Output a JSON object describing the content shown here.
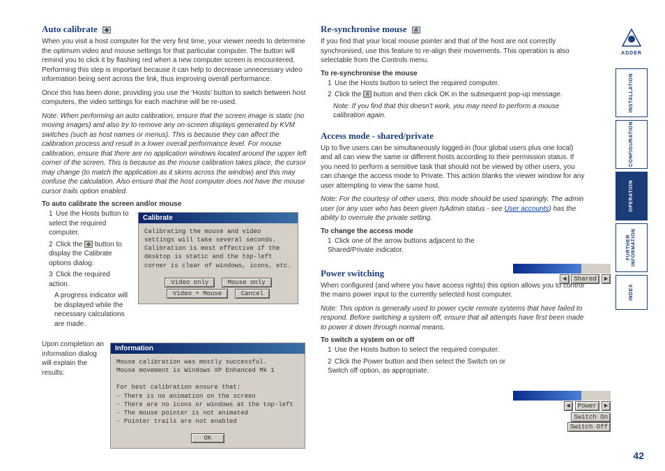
{
  "left": {
    "h1": "Auto calibrate",
    "p1": "When you visit a host computer for the very first time, your viewer needs to determine the optimum video and mouse settings for that particular computer. The button will remind you to click it by flashing red when a new computer screen is encountered. Performing this step is important because it can help to decrease unnecessary video information being sent across the link, thus improving overall performance.",
    "p2": "Once this has been done, providing you use the 'Hosts' button to switch between host computers, the video settings for each machine will be re-used.",
    "note1": "Note: When performing an auto calibration, ensure that the screen image is static (no moving images) and also try to remove any on-screen displays generated by KVM switches (such as host names or menus). This is because they can affect the calibration process and result in a lower overall performance level. For mouse calibration, ensure that there are no application windows located around the upper left corner of the screen. This is because as the mouse calibration takes place, the cursor may change (to match the application as it skims across the window) and this may confuse the calculation. Also ensure that the host computer does not have the mouse cursor trails option enabled.",
    "sub1": "To auto calibrate the screen and/or mouse",
    "li1": "Use the Hosts button to select the required computer.",
    "li2a": "Click the ",
    "li2b": " button to display the Calibrate options dialog:",
    "li3": "Click the required action.",
    "li3b": "A progress indicator will be displayed while the necessary calculations are made.",
    "completion": "Upon completion an information dialog will explain the results:",
    "dialog1": {
      "title": "Calibrate",
      "body": "Calibrating the mouse and video settings will take several seconds. Calibration is most effective if the desktop is static and the top-left corner is clear of windows, icons, etc.",
      "b1": "Video only",
      "b2": "Mouse only",
      "b3": "Video + Mouse",
      "b4": "Cancel"
    },
    "dialog2": {
      "title": "Information",
      "l1": "Mouse calibration was mostly successful.",
      "l2": "Mouse movement is Windows XP Enhanced Mk 1",
      "l3": "For best calibration ensure that:",
      "l4": "- There is no animation on the screen",
      "l5": "- There are no icons or windows at the top-left",
      "l6": "- The mouse pointer is not animated",
      "l7": "- Pointer trails are not enabled",
      "ok": "OK"
    }
  },
  "right": {
    "h1": "Re-synchronise mouse",
    "p1": "If you find that your local mouse pointer and that of the host are not correctly synchronised, use this feature to re-align their movements. This operation is also selectable from the Controls menu.",
    "sub1": "To re-synchronise the mouse",
    "li1": "Use the Hosts button to select the required computer.",
    "li2a": "Click the ",
    "li2b": " button and then click OK in the subsequent pop-up message.",
    "note1": "Note: If you find that this doesn't work, you may need to perform a mouse calibration again.",
    "h2": "Access mode - shared/private",
    "p2": "Up to five users can be simultaneously logged-in (four global users plus one local) and all can view the same or different hosts according to their permission status. If you need to perform a sensitive task that should not be viewed by other users, you can change the access mode to Private. This action blanks the viewer window for any user attempting to view the same host.",
    "note2a": "Note: For the courtesy of other users, this mode should be used sparingly. The admin user (or any user who has been given IsAdmin status - see ",
    "note2link": "User accounts",
    "note2b": ") has the ability to overrule the private setting.",
    "sub2": "To change the access mode",
    "li3": "Click one of the arrow buttons adjacent to the Shared/Private indicator.",
    "h3": "Power switching",
    "p3": "When configured (and where you have access rights) this option allows you to control the mains power input to the currently selected host computer.",
    "note3": "Note: This option is generally used to power cycle remote systems that have failed to respond. Before switching a system off, ensure that all attempts have first been made to power it down through normal means.",
    "sub3": "To switch a system on or off",
    "li4": "Use the Hosts button to select the required computer.",
    "li5": "Click the Power button and then select the Switch on or Switch off option, as appropriate."
  },
  "widgets": {
    "shared": "Shared",
    "power": "Power",
    "swon": "Switch On",
    "swoff": "Switch Off"
  },
  "sidebar": {
    "brand": "ADDER",
    "t1": "INSTALLATION",
    "t2": "CONFIGURATION",
    "t3": "OPERATION",
    "t4": "FURTHER\nINFORMATION",
    "t5": "INDEX"
  },
  "pagenum": "42"
}
